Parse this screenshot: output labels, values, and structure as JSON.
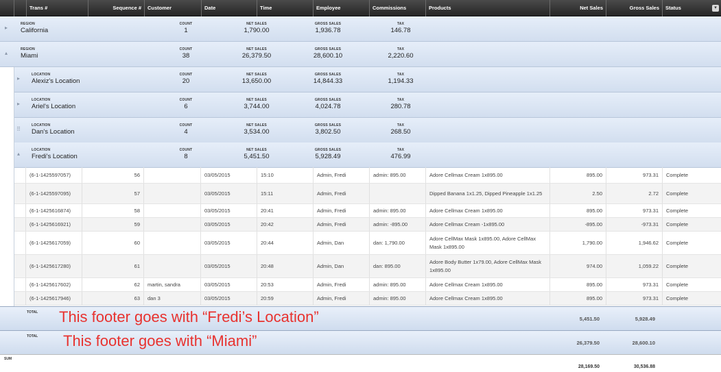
{
  "columns": [
    "Trans #",
    "Sequence #",
    "Customer",
    "Date",
    "Time",
    "Employee",
    "Commissions",
    "Products",
    "Net Sales",
    "Gross Sales",
    "Status"
  ],
  "menu_icon": "▾",
  "groups": {
    "california": {
      "label": "REGION",
      "name": "California",
      "count_label": "COUNT",
      "count": "1",
      "net_label": "NET SALES",
      "net": "1,790.00",
      "gross_label": "GROSS SALES",
      "gross": "1,936.78",
      "tax_label": "TAX",
      "tax": "146.78"
    },
    "miami": {
      "label": "REGION",
      "name": "Miami",
      "count_label": "COUNT",
      "count": "38",
      "net_label": "NET SALES",
      "net": "26,379.50",
      "gross_label": "GROSS SALES",
      "gross": "28,600.10",
      "tax_label": "TAX",
      "tax": "2,220.60"
    },
    "alexiz": {
      "label": "LOCATION",
      "name": "Alexiz's Location",
      "count_label": "COUNT",
      "count": "20",
      "net_label": "NET SALES",
      "net": "13,650.00",
      "gross_label": "GROSS SALES",
      "gross": "14,844.33",
      "tax_label": "TAX",
      "tax": "1,194.33"
    },
    "ariel": {
      "label": "LOCATION",
      "name": "Ariel's Location",
      "count_label": "COUNT",
      "count": "6",
      "net_label": "NET SALES",
      "net": "3,744.00",
      "gross_label": "GROSS SALES",
      "gross": "4,024.78",
      "tax_label": "TAX",
      "tax": "280.78"
    },
    "dan": {
      "label": "LOCATION",
      "name": "Dan's Location",
      "count_label": "COUNT",
      "count": "4",
      "net_label": "NET SALES",
      "net": "3,534.00",
      "gross_label": "GROSS SALES",
      "gross": "3,802.50",
      "tax_label": "TAX",
      "tax": "268.50"
    },
    "fredi": {
      "label": "LOCATION",
      "name": "Fredi's Location",
      "count_label": "COUNT",
      "count": "8",
      "net_label": "NET SALES",
      "net": "5,451.50",
      "gross_label": "GROSS SALES",
      "gross": "5,928.49",
      "tax_label": "TAX",
      "tax": "476.99"
    }
  },
  "rows": [
    {
      "trans": "(6-1-1425597057)",
      "seq": "56",
      "customer": "",
      "date": "03/05/2015",
      "time": "15:10",
      "employee": "Admin, Fredi",
      "commissions": "admin: 895.00",
      "products": "Adore Cellmax Cream 1x895.00",
      "net": "895.00",
      "gross": "973.31",
      "status": "Complete"
    },
    {
      "trans": "(6-1-1425597095)",
      "seq": "57",
      "customer": "",
      "date": "03/05/2015",
      "time": "15:11",
      "employee": "Admin, Fredi",
      "commissions": "",
      "products": "Dipped Banana 1x1.25, Dipped Pineapple 1x1.25",
      "net": "2.50",
      "gross": "2.72",
      "status": "Complete"
    },
    {
      "trans": "(6-1-1425616874)",
      "seq": "58",
      "customer": "",
      "date": "03/05/2015",
      "time": "20:41",
      "employee": "Admin, Fredi",
      "commissions": "admin: 895.00",
      "products": "Adore Cellmax Cream 1x895.00",
      "net": "895.00",
      "gross": "973.31",
      "status": "Complete"
    },
    {
      "trans": "(6-1-1425616921)",
      "seq": "59",
      "customer": "",
      "date": "03/05/2015",
      "time": "20:42",
      "employee": "Admin, Fredi",
      "commissions": "admin: -895.00",
      "products": "Adore Cellmax Cream -1x895.00",
      "net": "-895.00",
      "gross": "-973.31",
      "status": "Complete"
    },
    {
      "trans": "(6-1-1425617059)",
      "seq": "60",
      "customer": "",
      "date": "03/05/2015",
      "time": "20:44",
      "employee": "Admin, Dan",
      "commissions": "dan: 1,790.00",
      "products": "Adore CellMax Mask 1x895.00, Adore CellMax Mask 1x895.00",
      "net": "1,790.00",
      "gross": "1,946.62",
      "status": "Complete"
    },
    {
      "trans": "(6-1-1425617280)",
      "seq": "61",
      "customer": "",
      "date": "03/05/2015",
      "time": "20:48",
      "employee": "Admin, Dan",
      "commissions": "dan: 895.00",
      "products": "Adore Body Butter 1x79.00, Adore CellMax Mask 1x895.00",
      "net": "974.00",
      "gross": "1,059.22",
      "status": "Complete"
    },
    {
      "trans": "(6-1-1425617602)",
      "seq": "62",
      "customer": "martin, sandra",
      "date": "03/05/2015",
      "time": "20:53",
      "employee": "Admin, Fredi",
      "commissions": "admin: 895.00",
      "products": "Adore Cellmax Cream 1x895.00",
      "net": "895.00",
      "gross": "973.31",
      "status": "Complete"
    },
    {
      "trans": "(6-1-1425617946)",
      "seq": "63",
      "customer": "dan 3",
      "date": "03/05/2015",
      "time": "20:59",
      "employee": "Admin, Fredi",
      "commissions": "admin: 895.00",
      "products": "Adore Cellmax Cream 1x895.00",
      "net": "895.00",
      "gross": "973.31",
      "status": "Complete"
    }
  ],
  "footers": {
    "fredi": {
      "label": "TOTAL",
      "note": "This footer goes with  “Fredi’s Location”",
      "net": "5,451.50",
      "gross": "5,928.49"
    },
    "miami": {
      "label": "TOTAL",
      "note": "This footer goes with  “Miami”",
      "net": "26,379.50",
      "gross": "28,600.10"
    }
  },
  "sum": {
    "label": "SUM",
    "net": "28,169.50",
    "gross": "30,536.88"
  },
  "colors": {
    "header_bg": "#2e2e2e",
    "group_bg": "#dbe5f3",
    "note_red": "#e8322f"
  }
}
